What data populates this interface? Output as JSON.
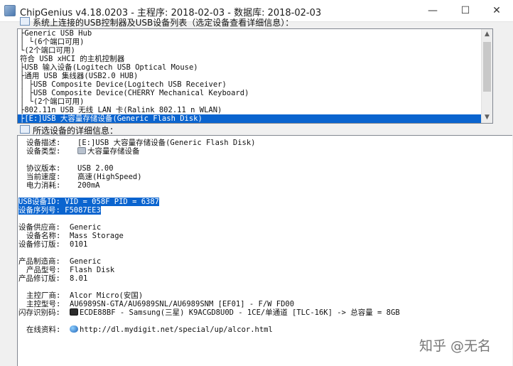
{
  "window": {
    "title": "ChipGenius v4.18.0203 - 主程序: 2018-02-03 - 数据库: 2018-02-03",
    "minimize": "—",
    "maximize": "☐",
    "close": "✕"
  },
  "device_list": {
    "label": "系统上连接的USB控制器及USB设备列表（选定设备查看详细信息）：",
    "items": [
      "├Generic USB Hub",
      "│ └(6个端口可用)",
      "└(2个端口可用)",
      "符合 USB xHCI 的主机控制器",
      "├USB 输入设备(Logitech USB Optical Mouse)",
      "├通用 USB 集线器(USB2.0 HUB)",
      "│ ├USB Composite Device(Logitech USB Receiver)",
      "│ ├USB Composite Device(CHERRY Mechanical Keyboard)",
      "│ └(2个端口可用)",
      "├802.11n USB 无线 LAN 卡(Ralink 802.11 n WLAN)",
      "├[E:]USB 大容量存储设备(Generic Flash Disk)"
    ],
    "selected_index": 10
  },
  "details": {
    "label": "所选设备的详细信息：",
    "device_desc_key": "设备描述:",
    "device_desc_val": "[E:]USB 大容量存储设备(Generic Flash Disk)",
    "device_type_key": "设备类型:",
    "device_type_val": "大容量存储设备",
    "protocol_key": "协议版本:",
    "protocol_val": "USB 2.00",
    "speed_key": "当前速度:",
    "speed_val": "高速(HighSpeed)",
    "power_key": "电力消耗:",
    "power_val": "200mA",
    "usb_id": "USB设备ID: VID = 058F PID = 6387",
    "serial": "设备序列号: F5087EE3",
    "vendor_key": "设备供应商:",
    "vendor_val": "Generic",
    "dev_name_key": "设备名称:",
    "dev_name_val": "Mass Storage",
    "dev_rev_key": "设备修订版:",
    "dev_rev_val": "0101",
    "mfr_key": "产品制造商:",
    "mfr_val": "Generic",
    "model_key": "产品型号:",
    "model_val": "Flash Disk",
    "prod_rev_key": "产品修订版:",
    "prod_rev_val": "8.01",
    "ctrl_vendor_key": "主控厂商:",
    "ctrl_vendor_val": "Alcor Micro(安国)",
    "ctrl_model_key": "主控型号:",
    "ctrl_model_val": "AU6989SN-GTA/AU6989SNL/AU6989SNM [EF01] - F/W FD00",
    "flash_key": "闪存识别码:",
    "flash_val": "ECDE88BF - Samsung(三星) K9ACGD8U0D - 1CE/单通道 [TLC-16K] -> 总容量 = 8GB",
    "online_key": "在线资料:",
    "online_val": "http://dl.mydigit.net/special/up/alcor.html"
  },
  "watermark": "知乎 @无名",
  "colors": {
    "selection": "#0a64cf",
    "window_bg": "#f0f0f0"
  },
  "icons": [
    "app-icon",
    "device-list-icon",
    "details-icon",
    "disk-icon",
    "chip-icon",
    "globe-icon"
  ]
}
